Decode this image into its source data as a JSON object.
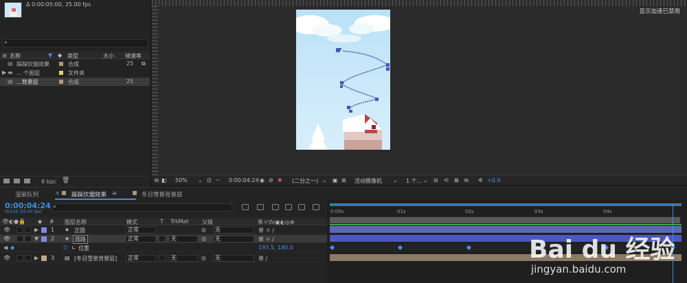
{
  "project": {
    "info": "Δ 0:00:05:00, 25.00 fps",
    "columns": {
      "name": "名称",
      "type": "类型",
      "size": "大小",
      "fps": "帧速率"
    },
    "items": [
      {
        "name": "跺跺炊烟效果",
        "type": "合成",
        "fps": "25",
        "color": "#b09a7a"
      },
      {
        "name": "... 个图层",
        "type": "文件夹",
        "fps": "",
        "color": "#e3d25a"
      },
      {
        "name": "...背景层",
        "type": "合成",
        "fps": "25",
        "color": "#b09a7a"
      }
    ],
    "bpc": "8 bpc"
  },
  "viewer": {
    "gpu_label": "显示加速已禁用",
    "zoom": "50%",
    "timecode": "0:00:04:24",
    "resolution": "(二分之一)",
    "camera": "活动摄像机",
    "view": "1 个...",
    "exposure": "+0.0"
  },
  "tabs": [
    {
      "label": "渲染队列"
    },
    {
      "label": "跺跺炊烟效果"
    },
    {
      "label": "冬日雪景背景层"
    }
  ],
  "timeline": {
    "timecode": "0:00:04:24",
    "timecode_sub": "00124 (25.00 fps)",
    "headers": {
      "num": "#",
      "layer_name": "图层名称",
      "mode": "模式",
      "t": "T",
      "trkmat": "TrkMat",
      "parent": "父级"
    },
    "layers": [
      {
        "num": "1",
        "name": "正圆",
        "mode": "正常",
        "trkmat": "",
        "parent": "无",
        "color": "#7d8ae6"
      },
      {
        "num": "2",
        "name": "圆路",
        "mode": "正常",
        "trkmat": "无",
        "parent": "无",
        "color": "#7d8ae6"
      },
      {
        "num": "3",
        "name": "[冬日雪景背景层]",
        "mode": "正常",
        "trkmat": "无",
        "parent": "无",
        "color": "#c2a785"
      }
    ],
    "property": {
      "name": "位置",
      "value": "193.5, 180.0"
    },
    "ruler": [
      "0:00s",
      "01s",
      "02s",
      "03s",
      "04s"
    ]
  },
  "watermark": {
    "logo": "Bai du 经验",
    "url": "jingyan.baidu.com"
  }
}
